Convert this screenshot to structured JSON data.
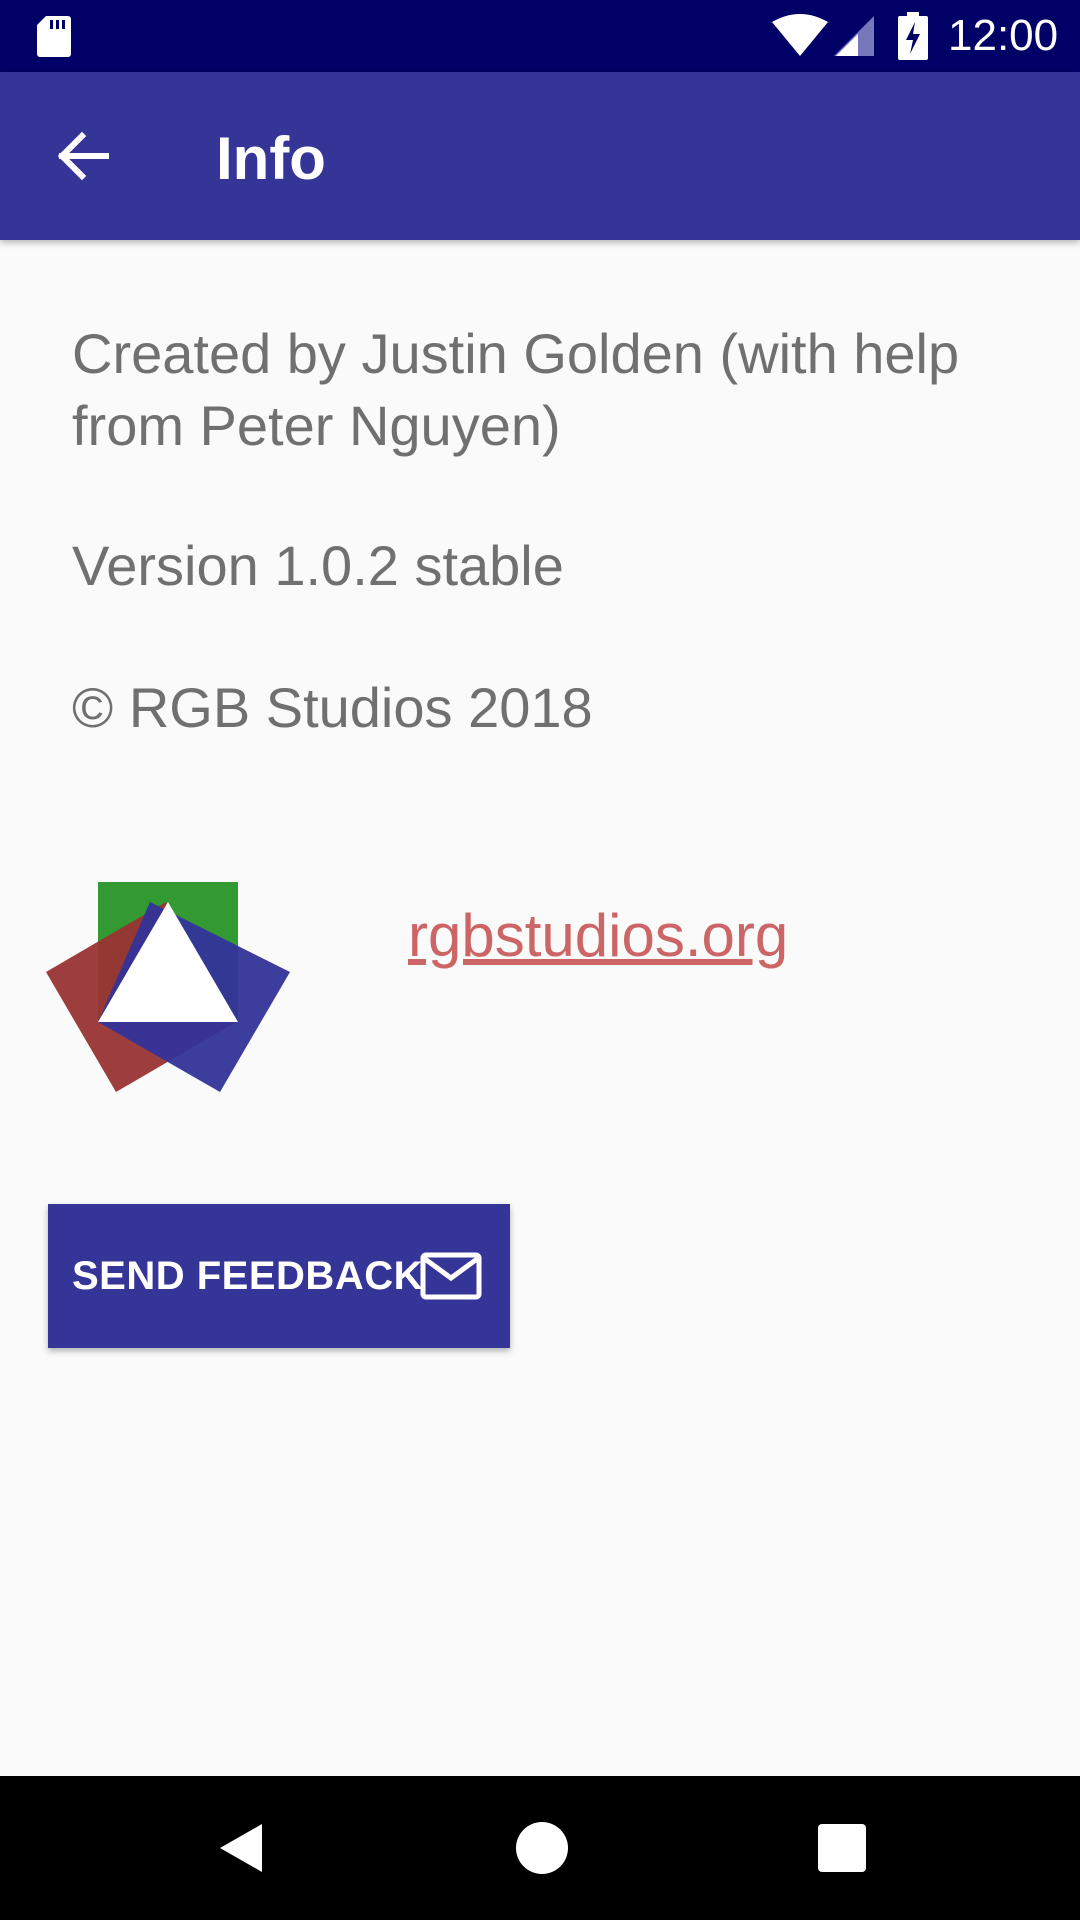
{
  "status_bar": {
    "time": "12:00",
    "icons": [
      "sd-card-icon",
      "wifi-icon",
      "signal-icon",
      "battery-charging-icon"
    ]
  },
  "app_bar": {
    "title": "Info",
    "back_icon": "arrow-back-icon"
  },
  "content": {
    "credits": "Created by Justin Golden (with help from Peter Nguyen)",
    "version": "Version 1.0.2 stable",
    "copyright": "© RGB Studios 2018",
    "website_link": "rgbstudios.org",
    "logo_icon": "rgb-studios-logo"
  },
  "feedback_button": {
    "label": "SEND FEEDBACK",
    "icon": "mail-icon"
  },
  "navigation_bar": {
    "icons": [
      "nav-back-icon",
      "nav-home-icon",
      "nav-recents-icon"
    ]
  },
  "colors": {
    "status_bar": "#000066",
    "primary": "#353597",
    "background": "#fafafa",
    "body_text": "#707070",
    "link": "#cc6666",
    "logo_red": "#993333",
    "logo_green": "#339933",
    "logo_blue": "#333399"
  }
}
